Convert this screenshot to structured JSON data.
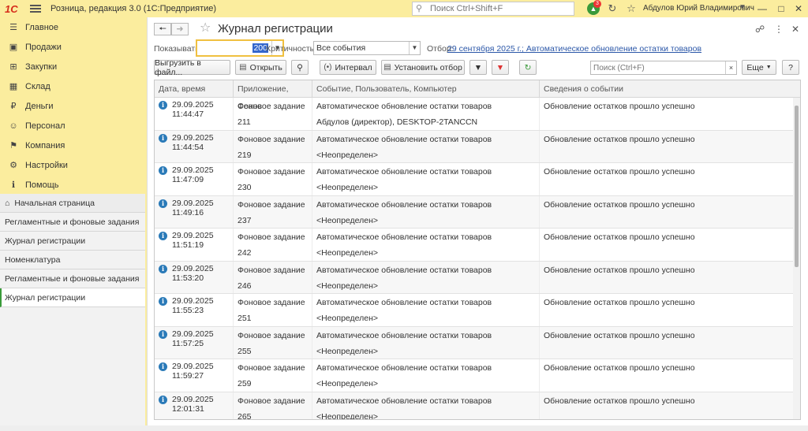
{
  "app": {
    "logo": "1С",
    "title": "Розница, редакция 3.0  (1С:Предприятие)",
    "search_placeholder": "Поиск Ctrl+Shift+F",
    "notifications_count": "3",
    "user": "Абдулов Юрий Владимирович",
    "accent": "#fbed9e"
  },
  "sidebar": {
    "items": [
      {
        "label": "Главное",
        "icon": "menu-icon"
      },
      {
        "label": "Продажи",
        "icon": "shop-icon"
      },
      {
        "label": "Закупки",
        "icon": "cart-icon"
      },
      {
        "label": "Склад",
        "icon": "warehouse-icon"
      },
      {
        "label": "Деньги",
        "icon": "ruble-icon"
      },
      {
        "label": "Персонал",
        "icon": "people-icon"
      },
      {
        "label": "Компания",
        "icon": "flag-icon"
      },
      {
        "label": "Настройки",
        "icon": "gear-icon"
      },
      {
        "label": "Помощь",
        "icon": "help-icon"
      }
    ],
    "opened": [
      {
        "label": "Начальная страница"
      },
      {
        "label": "Регламентные и фоновые задания"
      },
      {
        "label": "Журнал регистрации"
      },
      {
        "label": "Номенклатура"
      },
      {
        "label": "Регламентные и фоновые задания"
      },
      {
        "label": "Журнал регистрации"
      }
    ]
  },
  "form": {
    "title": "Журнал регистрации",
    "show_label": "Показывать:",
    "show_value": "200",
    "criticality_label": "Критичность:",
    "criticality_value": "Все события",
    "filter_label": "Отбор:",
    "filter_value": "29 сентября 2025 г.; Автоматическое обновление остатки товаров",
    "more_label": "Еще",
    "help_label": "?"
  },
  "toolbar": {
    "export": "Выгрузить в файл...",
    "open": "Открыть",
    "interval": "Интервал",
    "set_filter": "Установить отбор",
    "search_placeholder": "Поиск (Ctrl+F)"
  },
  "table": {
    "columns": [
      "Дата, время",
      "Приложение, Сеанс",
      "Событие, Пользователь, Компьютер",
      "Сведения о событии"
    ],
    "rows": [
      {
        "date": "29.09.2025",
        "time": "11:44:47",
        "app": "Фоновое задание",
        "session": "211",
        "event": "Автоматическое обновление остатки товаров",
        "user": "Абдулов (директор), DESKTOP-2TANCCN",
        "info": "Обновление остатков прошло успешно"
      },
      {
        "date": "29.09.2025",
        "time": "11:44:54",
        "app": "Фоновое задание",
        "session": "219",
        "event": "Автоматическое обновление остатки товаров",
        "user": "<Неопределен>",
        "info": "Обновление остатков прошло успешно"
      },
      {
        "date": "29.09.2025",
        "time": "11:47:09",
        "app": "Фоновое задание",
        "session": "230",
        "event": "Автоматическое обновление остатки товаров",
        "user": "<Неопределен>",
        "info": "Обновление остатков прошло успешно"
      },
      {
        "date": "29.09.2025",
        "time": "11:49:16",
        "app": "Фоновое задание",
        "session": "237",
        "event": "Автоматическое обновление остатки товаров",
        "user": "<Неопределен>",
        "info": "Обновление остатков прошло успешно"
      },
      {
        "date": "29.09.2025",
        "time": "11:51:19",
        "app": "Фоновое задание",
        "session": "242",
        "event": "Автоматическое обновление остатки товаров",
        "user": "<Неопределен>",
        "info": "Обновление остатков прошло успешно"
      },
      {
        "date": "29.09.2025",
        "time": "11:53:20",
        "app": "Фоновое задание",
        "session": "246",
        "event": "Автоматическое обновление остатки товаров",
        "user": "<Неопределен>",
        "info": "Обновление остатков прошло успешно"
      },
      {
        "date": "29.09.2025",
        "time": "11:55:23",
        "app": "Фоновое задание",
        "session": "251",
        "event": "Автоматическое обновление остатки товаров",
        "user": "<Неопределен>",
        "info": "Обновление остатков прошло успешно"
      },
      {
        "date": "29.09.2025",
        "time": "11:57:25",
        "app": "Фоновое задание",
        "session": "255",
        "event": "Автоматическое обновление остатки товаров",
        "user": "<Неопределен>",
        "info": "Обновление остатков прошло успешно"
      },
      {
        "date": "29.09.2025",
        "time": "11:59:27",
        "app": "Фоновое задание",
        "session": "259",
        "event": "Автоматическое обновление остатки товаров",
        "user": "<Неопределен>",
        "info": "Обновление остатков прошло успешно"
      },
      {
        "date": "29.09.2025",
        "time": "12:01:31",
        "app": "Фоновое задание",
        "session": "265",
        "event": "Автоматическое обновление остатки товаров",
        "user": "<Неопределен>",
        "info": "Обновление остатков прошло успешно"
      }
    ]
  }
}
